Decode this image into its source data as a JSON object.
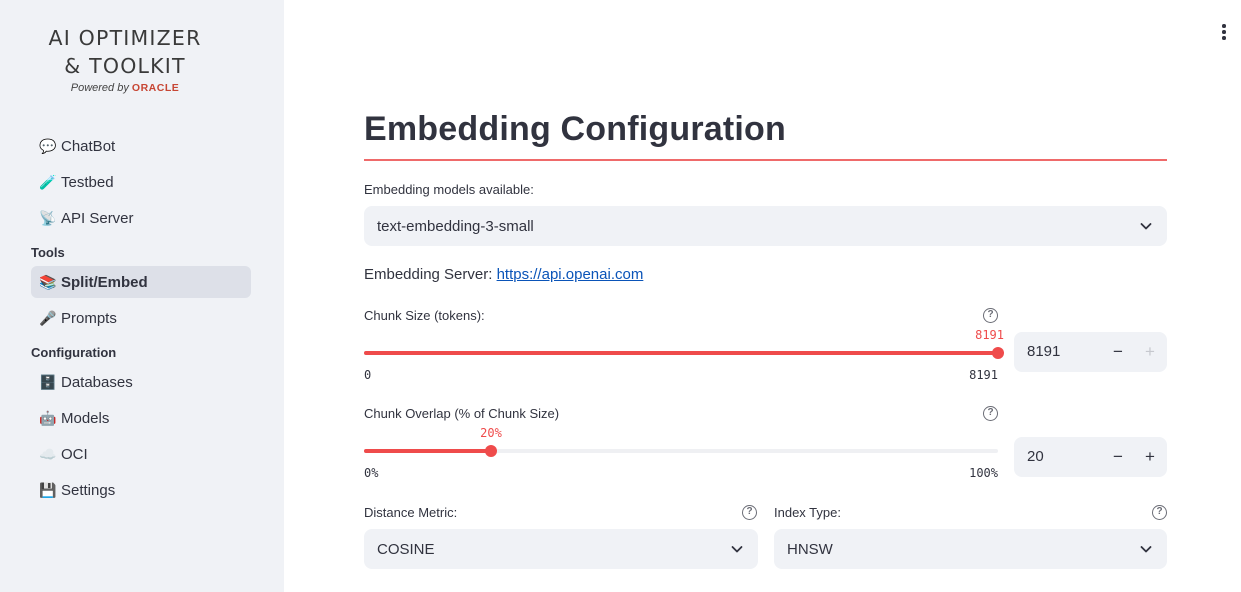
{
  "app": {
    "logo_line1": "AI OPTIMIZER",
    "logo_line2": "& TOOLKIT",
    "powered_by": "Powered by",
    "oracle": "ORACLE"
  },
  "sidebar": {
    "items": [
      {
        "icon": "💬",
        "label": "ChatBot"
      },
      {
        "icon": "🧪",
        "label": "Testbed"
      },
      {
        "icon": "📡",
        "label": "API Server"
      }
    ],
    "tools_header": "Tools",
    "tools": [
      {
        "icon": "📚",
        "label": "Split/Embed",
        "active": true
      },
      {
        "icon": "🎤",
        "label": "Prompts"
      }
    ],
    "config_header": "Configuration",
    "config": [
      {
        "icon": "🗄️",
        "label": "Databases"
      },
      {
        "icon": "🤖",
        "label": "Models"
      },
      {
        "icon": "☁️",
        "label": "OCI"
      },
      {
        "icon": "💾",
        "label": "Settings"
      }
    ]
  },
  "main": {
    "title": "Embedding Configuration",
    "models_label": "Embedding models available:",
    "model_selected": "text-embedding-3-small",
    "server_label": "Embedding Server:",
    "server_url": "https://api.openai.com",
    "chunk_size": {
      "label": "Chunk Size (tokens):",
      "value": "8191",
      "min": "0",
      "max": "8191",
      "fraction": 1.0,
      "input_value": "8191"
    },
    "chunk_overlap": {
      "label": "Chunk Overlap (% of Chunk Size)",
      "value": "20%",
      "min": "0%",
      "max": "100%",
      "fraction": 0.2,
      "input_value": "20"
    },
    "distance_metric": {
      "label": "Distance Metric:",
      "selected": "COSINE"
    },
    "index_type": {
      "label": "Index Type:",
      "selected": "HNSW"
    }
  },
  "colors": {
    "accent": "#ef4b4b",
    "sidebar_bg": "#f0f2f6",
    "link": "#0a54b8"
  }
}
